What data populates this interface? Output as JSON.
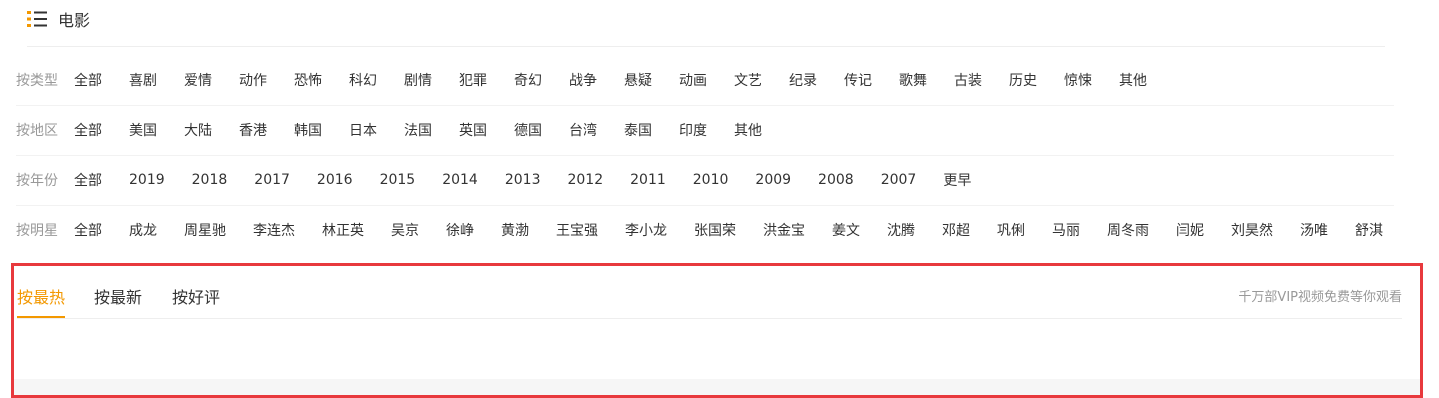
{
  "header": {
    "title": "电影",
    "icon": "list-icon",
    "icon_accent": "#f39800"
  },
  "filters": {
    "genre": {
      "label": "按类型",
      "options": [
        "全部",
        "喜剧",
        "爱情",
        "动作",
        "恐怖",
        "科幻",
        "剧情",
        "犯罪",
        "奇幻",
        "战争",
        "悬疑",
        "动画",
        "文艺",
        "纪录",
        "传记",
        "歌舞",
        "古装",
        "历史",
        "惊悚",
        "其他"
      ]
    },
    "region": {
      "label": "按地区",
      "options": [
        "全部",
        "美国",
        "大陆",
        "香港",
        "韩国",
        "日本",
        "法国",
        "英国",
        "德国",
        "台湾",
        "泰国",
        "印度",
        "其他"
      ]
    },
    "year": {
      "label": "按年份",
      "options": [
        "全部",
        "2019",
        "2018",
        "2017",
        "2016",
        "2015",
        "2014",
        "2013",
        "2012",
        "2011",
        "2010",
        "2009",
        "2008",
        "2007",
        "更早"
      ]
    },
    "star": {
      "label": "按明星",
      "options": [
        "全部",
        "成龙",
        "周星驰",
        "李连杰",
        "林正英",
        "吴京",
        "徐峥",
        "黄渤",
        "王宝强",
        "李小龙",
        "张国荣",
        "洪金宝",
        "姜文",
        "沈腾",
        "邓超",
        "巩俐",
        "马丽",
        "周冬雨",
        "闫妮",
        "刘昊然",
        "汤唯",
        "舒淇"
      ]
    }
  },
  "sort_tabs": {
    "tabs": [
      "按最热",
      "按最新",
      "按好评"
    ],
    "active_index": 0,
    "promo": "千万部VIP视频免费等你观看"
  },
  "colors": {
    "accent": "#f39800",
    "highlight_border": "#e8393d",
    "label_gray": "#999999"
  }
}
